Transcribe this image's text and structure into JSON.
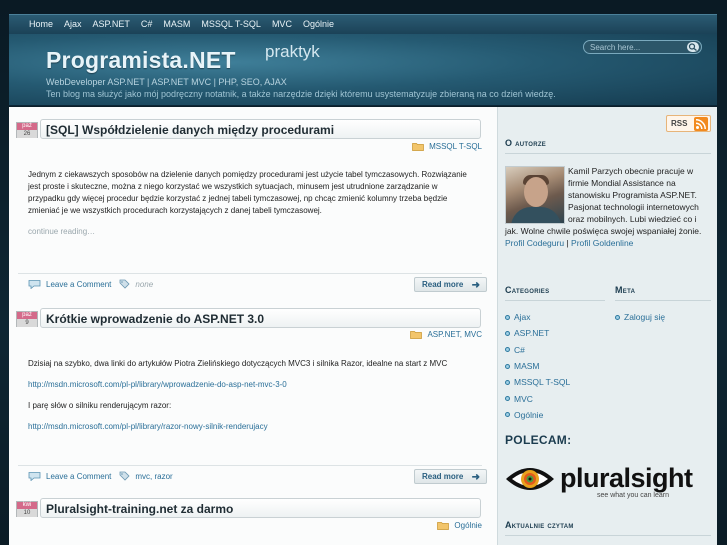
{
  "nav": {
    "items": [
      "Home",
      "Ajax",
      "ASP.NET",
      "C#",
      "MASM",
      "MSSQL T-SQL",
      "MVC",
      "Ogólnie"
    ]
  },
  "header": {
    "title": "Programista.NET",
    "title_suffix": "praktyk",
    "subtitle": "WebDeveloper ASP.NET | ASP.NET MVC | PHP, SEO, AJAX",
    "description": "Ten blog ma służyć jako mój podręczny notatnik, a także narzędzie dzięki któremu usystematyzuje zbieraną na co dzień wiedzę.",
    "search_placeholder": "Search here..."
  },
  "posts": [
    {
      "month": "paź",
      "day": "26",
      "title": "[SQL] Współdzielenie danych między procedurami",
      "categories": "MSSQL T-SQL",
      "body": [
        "Jednym z ciekawszych sposobów na dzielenie danych pomiędzy procedurami jest użycie tabel tymczasowych. Rozwiązanie jest proste i skuteczne, można z niego korzystać we wszystkich sytuacjach, minusem jest utrudnione zarządzanie w przypadku gdy więcej procedur będzie korzystać z jednej tabeli tymczasowej, np chcąc zmienić kolumny trzeba będzie zmieniać je we wszystkich procedurach korzystających z danej tabeli tymczasowej."
      ],
      "continue_text": "continue reading…",
      "comment_label": "Leave a Comment",
      "tags": "none",
      "read_more": "Read more"
    },
    {
      "month": "paź",
      "day": "9",
      "title": "Krótkie wprowadzenie do ASP.NET 3.0",
      "categories": "ASP.NET, MVC",
      "body": [
        "Dzisiaj na szybko, dwa linki do artykułów Piotra Zielińskiego dotyczących MVC3 i silnika Razor, idealne na start z MVC",
        "http://msdn.microsoft.com/pl-pl/library/wprowadzenie-do-asp-net-mvc-3-0",
        "I parę słów o silniku renderującym razor:",
        "http://msdn.microsoft.com/pl-pl/library/razor-nowy-silnik-renderujacy"
      ],
      "comment_label": "Leave a Comment",
      "tags": "mvc, razor",
      "read_more": "Read more"
    },
    {
      "month": "kwi",
      "day": "10",
      "title": "Pluralsight-training.net za darmo",
      "categories": "Ogólnie"
    }
  ],
  "sidebar": {
    "rss_label": "RSS",
    "about": {
      "heading": "O autorze",
      "text": "Kamil Parzych obecnie pracuje w firmie Mondial Assistance na stanowisku Programista ASP.NET. Pasjonat technologii internetowych oraz mobilnych. Lubi wiedzieć co i jak. Wolne chwile poświęca swojej wspaniałej żonie.",
      "link1": "Profil Codeguru",
      "separator": "|",
      "link2": "Profil Goldenline"
    },
    "categories": {
      "heading": "Categories",
      "items": [
        "Ajax",
        "ASP.NET",
        "C#",
        "MASM",
        "MSSQL T-SQL",
        "MVC",
        "Ogólnie"
      ]
    },
    "meta": {
      "heading": "Meta",
      "items": [
        "Zaloguj się"
      ]
    },
    "polecam": {
      "heading": "POLECAM:",
      "logo_word": "pluralsight",
      "logo_tagline": "see what you can learn"
    },
    "reading": {
      "heading": "Aktualnie czytam"
    }
  },
  "colors": {
    "link": "#2a6f98",
    "header_bg": "#255a72",
    "date_badge": "#d46a8a"
  }
}
